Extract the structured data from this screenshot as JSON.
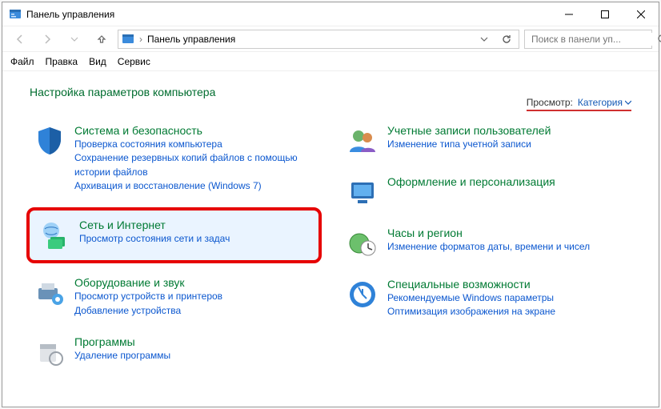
{
  "window": {
    "title": "Панель управления"
  },
  "address": {
    "text": "Панель управления"
  },
  "search": {
    "placeholder": "Поиск в панели уп..."
  },
  "menu": {
    "file": "Файл",
    "edit": "Правка",
    "view": "Вид",
    "tools": "Сервис"
  },
  "heading": "Настройка параметров компьютера",
  "viewLabel": "Просмотр:",
  "viewValue": "Категория",
  "left": [
    {
      "title": "Система и безопасность",
      "links": [
        "Проверка состояния компьютера",
        "Сохранение резервных копий файлов с помощью истории файлов",
        "Архивация и восстановление (Windows 7)"
      ]
    },
    {
      "title": "Сеть и Интернет",
      "links": [
        "Просмотр состояния сети и задач"
      ]
    },
    {
      "title": "Оборудование и звук",
      "links": [
        "Просмотр устройств и принтеров",
        "Добавление устройства"
      ]
    },
    {
      "title": "Программы",
      "links": [
        "Удаление программы"
      ]
    }
  ],
  "right": [
    {
      "title": "Учетные записи пользователей",
      "links": [
        "Изменение типа учетной записи"
      ]
    },
    {
      "title": "Оформление и персонализация",
      "links": []
    },
    {
      "title": "Часы и регион",
      "links": [
        "Изменение форматов даты, времени и чисел"
      ]
    },
    {
      "title": "Специальные возможности",
      "links": [
        "Рекомендуемые Windows параметры",
        "Оптимизация изображения на экране"
      ]
    }
  ]
}
